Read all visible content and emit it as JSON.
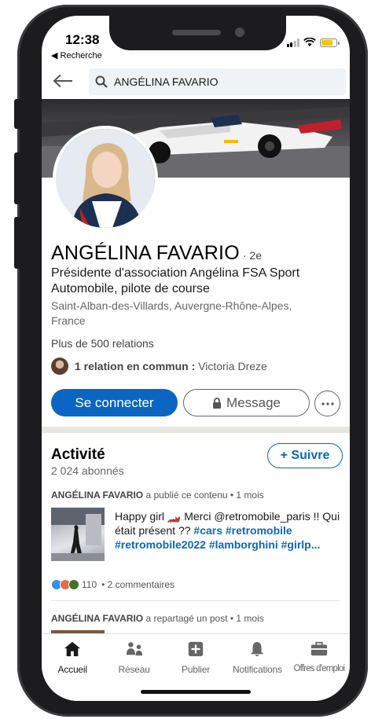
{
  "status_bar": {
    "time": "12:38",
    "back_label": "◀ Recherche",
    "battery_color": "#f5c400"
  },
  "search": {
    "query": "ANGÉLINA FAVARIO"
  },
  "profile": {
    "name": "ANGÉLINA FAVARIO",
    "degree": "· 2e",
    "headline": "Présidente d'association Angélina FSA  Sport Automobile, pilote de course",
    "location": "Saint-Alban-des-Villards, Auvergne-Rhône-Alpes, France",
    "relations": "Plus de 500 relations",
    "mutual_count": "1 relation en commun :",
    "mutual_name": " Victoria Dreze"
  },
  "actions": {
    "connect": "Se connecter",
    "message": "Message",
    "more_icon": "ellipsis-icon"
  },
  "activity": {
    "title": "Activité",
    "followers": "2 024 abonnés",
    "follow_button": "+ Suivre",
    "posts": [
      {
        "author": "ANGÉLINA FAVARIO",
        "action": " a publié ce contenu • 1 mois",
        "text": "Happy girl 🏎️ Merci @retromobile_paris !! Qui était présent ?? ",
        "tags": "#cars #retromobile #retromobile2022 #lamborghini #girlp...",
        "reaction_count": "110",
        "comments": "• 2 commentaires"
      },
      {
        "author": "ANGÉLINA FAVARIO",
        "action": " a repartagé un post • 1 mois"
      }
    ]
  },
  "nav": {
    "items": [
      {
        "label": "Accueil",
        "icon": "home-icon"
      },
      {
        "label": "Réseau",
        "icon": "network-icon"
      },
      {
        "label": "Publier",
        "icon": "post-icon"
      },
      {
        "label": "Notifications",
        "icon": "bell-icon"
      },
      {
        "label": "Offres d'emploi",
        "icon": "briefcase-icon"
      }
    ]
  },
  "colors": {
    "primary": "#0a66c2",
    "text": "#191919",
    "muted": "#666666"
  }
}
